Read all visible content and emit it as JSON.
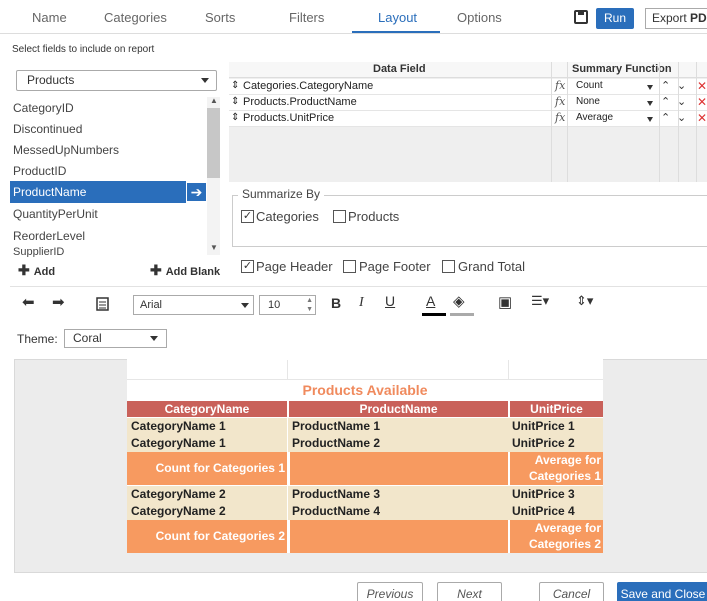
{
  "tabs": [
    "Name",
    "Categories",
    "Sorts",
    "Filters",
    "Layout",
    "Options"
  ],
  "toolbar": {
    "run": "Run",
    "export_prefix": "Export",
    "export_format": "PDF"
  },
  "select_label": "Select fields to include on report",
  "table_select": "Products",
  "fields": [
    "CategoryID",
    "Discontinued",
    "MessedUpNumbers",
    "ProductID",
    "ProductName",
    "QuantityPerUnit",
    "ReorderLevel",
    "SupplierID"
  ],
  "selected_field": "ProductName",
  "add_label": "Add",
  "add_blank_label": "Add Blank",
  "grid": {
    "headers": {
      "data_field": "Data Field",
      "summary_function": "Summary Function"
    },
    "rows": [
      {
        "field": "Categories.CategoryName",
        "function": "Count"
      },
      {
        "field": "Products.ProductName",
        "function": "None"
      },
      {
        "field": "Products.UnitPrice",
        "function": "Average"
      }
    ]
  },
  "summarize": {
    "legend": "Summarize By",
    "categories": "Categories",
    "products": "Products"
  },
  "options": {
    "page_header": "Page Header",
    "page_footer": "Page Footer",
    "grand_total": "Grand Total"
  },
  "format": {
    "font": "Arial",
    "size": "10"
  },
  "theme": {
    "label": "Theme:",
    "value": "Coral"
  },
  "report": {
    "title": "Products Available",
    "columns": [
      "CategoryName",
      "ProductName",
      "UnitPrice"
    ],
    "rows": [
      [
        "CategoryName 1",
        "ProductName 1",
        "UnitPrice 1"
      ],
      [
        "CategoryName 1",
        "ProductName 2",
        "UnitPrice 2"
      ]
    ],
    "summary1": {
      "count": "Count for Categories 1",
      "avg_line1": "Average for",
      "avg_line2": "Categories 1"
    },
    "rows2": [
      [
        "CategoryName 2",
        "ProductName 3",
        "UnitPrice 3"
      ],
      [
        "CategoryName 2",
        "ProductName 4",
        "UnitPrice 4"
      ]
    ],
    "summary2": {
      "count": "Count for Categories 2",
      "avg_line1": "Average for",
      "avg_line2": "Categories 2"
    }
  },
  "footer": {
    "previous": "Previous",
    "next": "Next",
    "cancel": "Cancel",
    "save_close": "Save and Close"
  },
  "colors": {
    "accent": "#2a6ebb",
    "header_red": "#c9615a",
    "title_orange": "#f08a5d",
    "summary_orange": "#f79a60",
    "row_cream": "#f2e6cb"
  }
}
